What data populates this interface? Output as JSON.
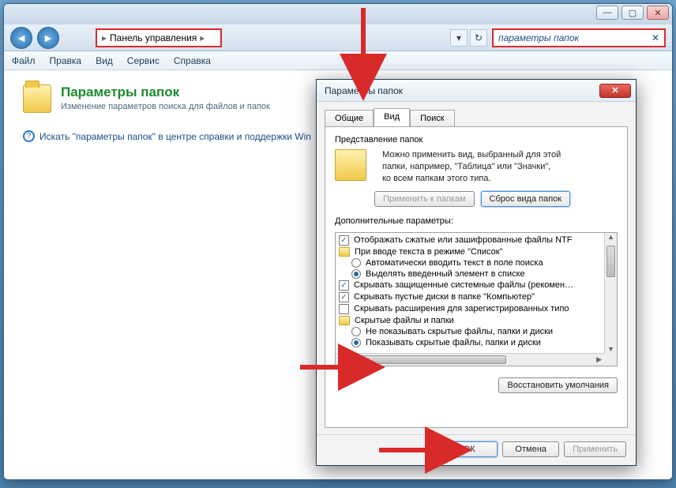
{
  "breadcrumb": "Панель управления",
  "search_text": "параметры папок",
  "menu": {
    "file": "Файл",
    "edit": "Правка",
    "view": "Вид",
    "tools": "Сервис",
    "help": "Справка"
  },
  "page": {
    "title": "Параметры папок",
    "subtitle": "Изменение параметров поиска для файлов и папок"
  },
  "help_link": "Искать \"параметры папок\" в центре справки и поддержки Win",
  "dialog": {
    "title": "Параметры папок",
    "tabs": {
      "general": "Общие",
      "view": "Вид",
      "search": "Поиск"
    },
    "group_label": "Представление папок",
    "group_text1": "Можно применить вид, выбранный для этой",
    "group_text2": "папки, например, \"Таблица\" или \"Значки\",",
    "group_text3": "ко всем папкам этого типа.",
    "apply_folders": "Применить к папкам",
    "reset_folders": "Сброс вида папок",
    "addl_label": "Дополнительные параметры:",
    "rows": [
      "Отображать сжатые или зашифрованные файлы NTF",
      "При вводе текста в режиме \"Список\"",
      "Автоматически вводить текст в поле поиска",
      "Выделять введенный элемент в списке",
      "Скрывать защищенные системные файлы (рекомен…",
      "Скрывать пустые диски в папке \"Компьютер\"",
      "Скрывать расширения для зарегистрированных типо",
      "Скрытые файлы и папки",
      "Не показывать скрытые файлы, папки и диски",
      "Показывать скрытые файлы, папки и диски"
    ],
    "restore": "Восстановить умолчания",
    "ok": "ОК",
    "cancel": "Отмена",
    "apply": "Применить"
  }
}
